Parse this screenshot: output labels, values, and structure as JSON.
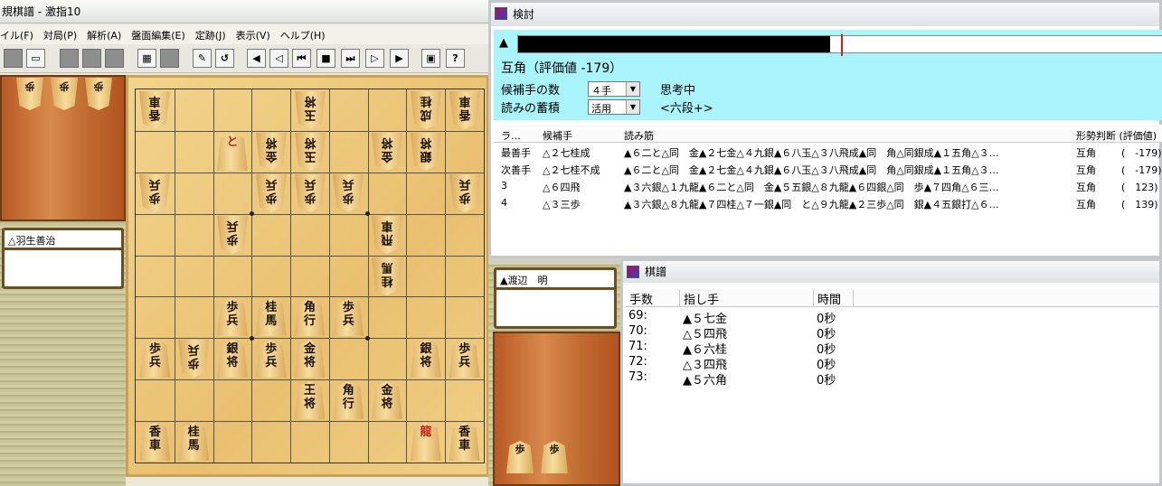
{
  "main_window": {
    "title": "規棋譜 - 激指10",
    "menu": [
      "イル(F)",
      "対局(P)",
      "解析(A)",
      "盤面編集(E)",
      "定跡(J)",
      "表示(V)",
      "ヘルプ(H)"
    ],
    "toolbar_icons": [
      "new-icon",
      "open-icon",
      "save-icon",
      "print-icon",
      "copy-icon",
      "paste-icon",
      "board-icon",
      "edit-icon",
      "undo-icon",
      "redo-icon",
      "first-icon",
      "prev-icon",
      "back-icon",
      "stop-icon",
      "forward-icon",
      "next-icon",
      "last-icon",
      "monitor-icon",
      "help-icon"
    ],
    "gote_player": "△羽生善治",
    "sente_player": "▲渡辺　明",
    "gote_hand": [
      "歩",
      "歩",
      "歩"
    ],
    "sente_hand": [
      "歩",
      "歩"
    ]
  },
  "board_pieces": [
    {
      "file": 9,
      "rank": 1,
      "p": "香車",
      "side": "g"
    },
    {
      "file": 5,
      "rank": 1,
      "p": "玉将",
      "side": "g"
    },
    {
      "file": 2,
      "rank": 1,
      "p": "成桂",
      "side": "g"
    },
    {
      "file": 1,
      "rank": 1,
      "p": "香車",
      "side": "g"
    },
    {
      "file": 7,
      "rank": 2,
      "p": "と",
      "side": "s",
      "red": true
    },
    {
      "file": 6,
      "rank": 2,
      "p": "金将",
      "side": "g"
    },
    {
      "file": 5,
      "rank": 2,
      "p": "玉将",
      "side": "g"
    },
    {
      "file": 3,
      "rank": 2,
      "p": "金将",
      "side": "g"
    },
    {
      "file": 2,
      "rank": 2,
      "p": "銀将",
      "side": "g"
    },
    {
      "file": 9,
      "rank": 3,
      "p": "歩兵",
      "side": "g"
    },
    {
      "file": 6,
      "rank": 3,
      "p": "歩兵",
      "side": "g"
    },
    {
      "file": 5,
      "rank": 3,
      "p": "歩兵",
      "side": "g"
    },
    {
      "file": 4,
      "rank": 3,
      "p": "歩兵",
      "side": "g"
    },
    {
      "file": 1,
      "rank": 3,
      "p": "歩兵",
      "side": "g"
    },
    {
      "file": 7,
      "rank": 4,
      "p": "歩兵",
      "side": "g"
    },
    {
      "file": 3,
      "rank": 4,
      "p": "飛車",
      "side": "g"
    },
    {
      "file": 3,
      "rank": 5,
      "p": "桂馬",
      "side": "g"
    },
    {
      "file": 7,
      "rank": 6,
      "p": "歩兵",
      "side": "s"
    },
    {
      "file": 6,
      "rank": 6,
      "p": "桂馬",
      "side": "s"
    },
    {
      "file": 5,
      "rank": 6,
      "p": "角行",
      "side": "s"
    },
    {
      "file": 4,
      "rank": 6,
      "p": "歩兵",
      "side": "s"
    },
    {
      "file": 9,
      "rank": 7,
      "p": "歩兵",
      "side": "s"
    },
    {
      "file": 8,
      "rank": 7,
      "p": "歩兵",
      "side": "g"
    },
    {
      "file": 7,
      "rank": 7,
      "p": "銀将",
      "side": "s"
    },
    {
      "file": 6,
      "rank": 7,
      "p": "歩兵",
      "side": "s"
    },
    {
      "file": 5,
      "rank": 7,
      "p": "金将",
      "side": "s"
    },
    {
      "file": 2,
      "rank": 7,
      "p": "銀将",
      "side": "s"
    },
    {
      "file": 1,
      "rank": 7,
      "p": "歩兵",
      "side": "s"
    },
    {
      "file": 5,
      "rank": 8,
      "p": "王将",
      "side": "s"
    },
    {
      "file": 4,
      "rank": 8,
      "p": "角行",
      "side": "s"
    },
    {
      "file": 3,
      "rank": 8,
      "p": "金将",
      "side": "s"
    },
    {
      "file": 9,
      "rank": 9,
      "p": "香車",
      "side": "s"
    },
    {
      "file": 8,
      "rank": 9,
      "p": "桂馬",
      "side": "s"
    },
    {
      "file": 2,
      "rank": 9,
      "p": "龍",
      "side": "s",
      "red": true
    },
    {
      "file": 1,
      "rank": 9,
      "p": "香車",
      "side": "s"
    }
  ],
  "kentou": {
    "title": "検討",
    "eval_marker": "▲",
    "eval_fill_fraction": 0.48,
    "eval_text": "互角（評価値 -179）",
    "candidates_label": "候補手の数",
    "candidates_value": "４手",
    "reading_label": "読みの蓄積",
    "reading_value": "活用",
    "status": "思考中",
    "level": "<六段+>",
    "headers": [
      "ラ…",
      "候補手",
      "読み筋",
      "形勢判断 (評価値)"
    ],
    "rows": [
      {
        "rank": "最善手",
        "move": "△２七桂成",
        "line": "▲６二と△同　金▲２七金△４九銀▲６八玉△３八飛成▲同　角△同銀成▲１五角△３…",
        "judge": "互角",
        "value": "(　-179)"
      },
      {
        "rank": "次善手",
        "move": "△２七桂不成",
        "line": "▲６二と△同　金▲２七金△４九銀▲６八玉△３八飛成▲同　角△同銀成▲１五角△３…",
        "judge": "互角",
        "value": "(　-179)"
      },
      {
        "rank": "3",
        "move": "△６四飛",
        "line": "▲３六銀△１九龍▲６二と△同　金▲５五銀△８九龍▲６四銀△同　歩▲７四角△６三…",
        "judge": "互角",
        "value": "(　123)"
      },
      {
        "rank": "4",
        "move": "△３三歩",
        "line": "▲３六銀△８九龍▲７四桂△７一銀▲同　と△９九龍▲２三歩△同　銀▲４五銀打△６…",
        "judge": "互角",
        "value": "(　139)"
      }
    ]
  },
  "kifu": {
    "title": "棋譜",
    "headers": [
      "手数",
      "指し手",
      "時間"
    ],
    "rows": [
      {
        "num": "69:",
        "move": "▲５七金",
        "time": "0秒"
      },
      {
        "num": "70:",
        "move": "△５四飛",
        "time": "0秒"
      },
      {
        "num": "71:",
        "move": "▲６六桂",
        "time": "0秒"
      },
      {
        "num": "72:",
        "move": "△３四飛",
        "time": "0秒"
      },
      {
        "num": "73:",
        "move": "▲５六角",
        "time": "0秒"
      }
    ]
  }
}
